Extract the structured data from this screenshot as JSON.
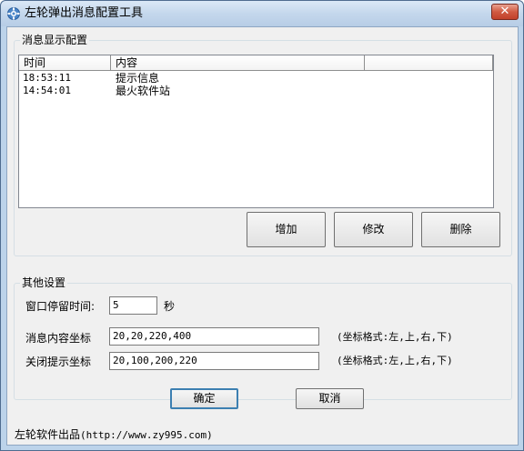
{
  "window": {
    "title": "左轮弹出消息配置工具",
    "close_symbol": "✕",
    "icon": "gear-icon"
  },
  "message_display": {
    "group_title": "消息显示配置",
    "columns": [
      "时间",
      "内容",
      ""
    ],
    "rows": [
      {
        "time": "18:53:11",
        "content": "提示信息"
      },
      {
        "time": "14:54:01",
        "content": "最火软件站"
      }
    ],
    "buttons": {
      "add": "增加",
      "edit": "修改",
      "delete": "删除"
    }
  },
  "other_settings": {
    "group_title": "其他设置",
    "stay_time_label": "窗口停留时间:",
    "stay_time_value": "5",
    "stay_time_unit": "秒",
    "content_coord_label": "消息内容坐标",
    "content_coord_value": "20,20,220,400",
    "content_coord_hint": "(坐标格式:左,上,右,下)",
    "close_coord_label": "关闭提示坐标",
    "close_coord_value": "20,100,200,220",
    "close_coord_hint": "(坐标格式:左,上,右,下)"
  },
  "actions": {
    "ok": "确定",
    "cancel": "取消"
  },
  "footer": {
    "brand": "左轮软件出品",
    "url_text": "(http://www.zy995.com)"
  }
}
